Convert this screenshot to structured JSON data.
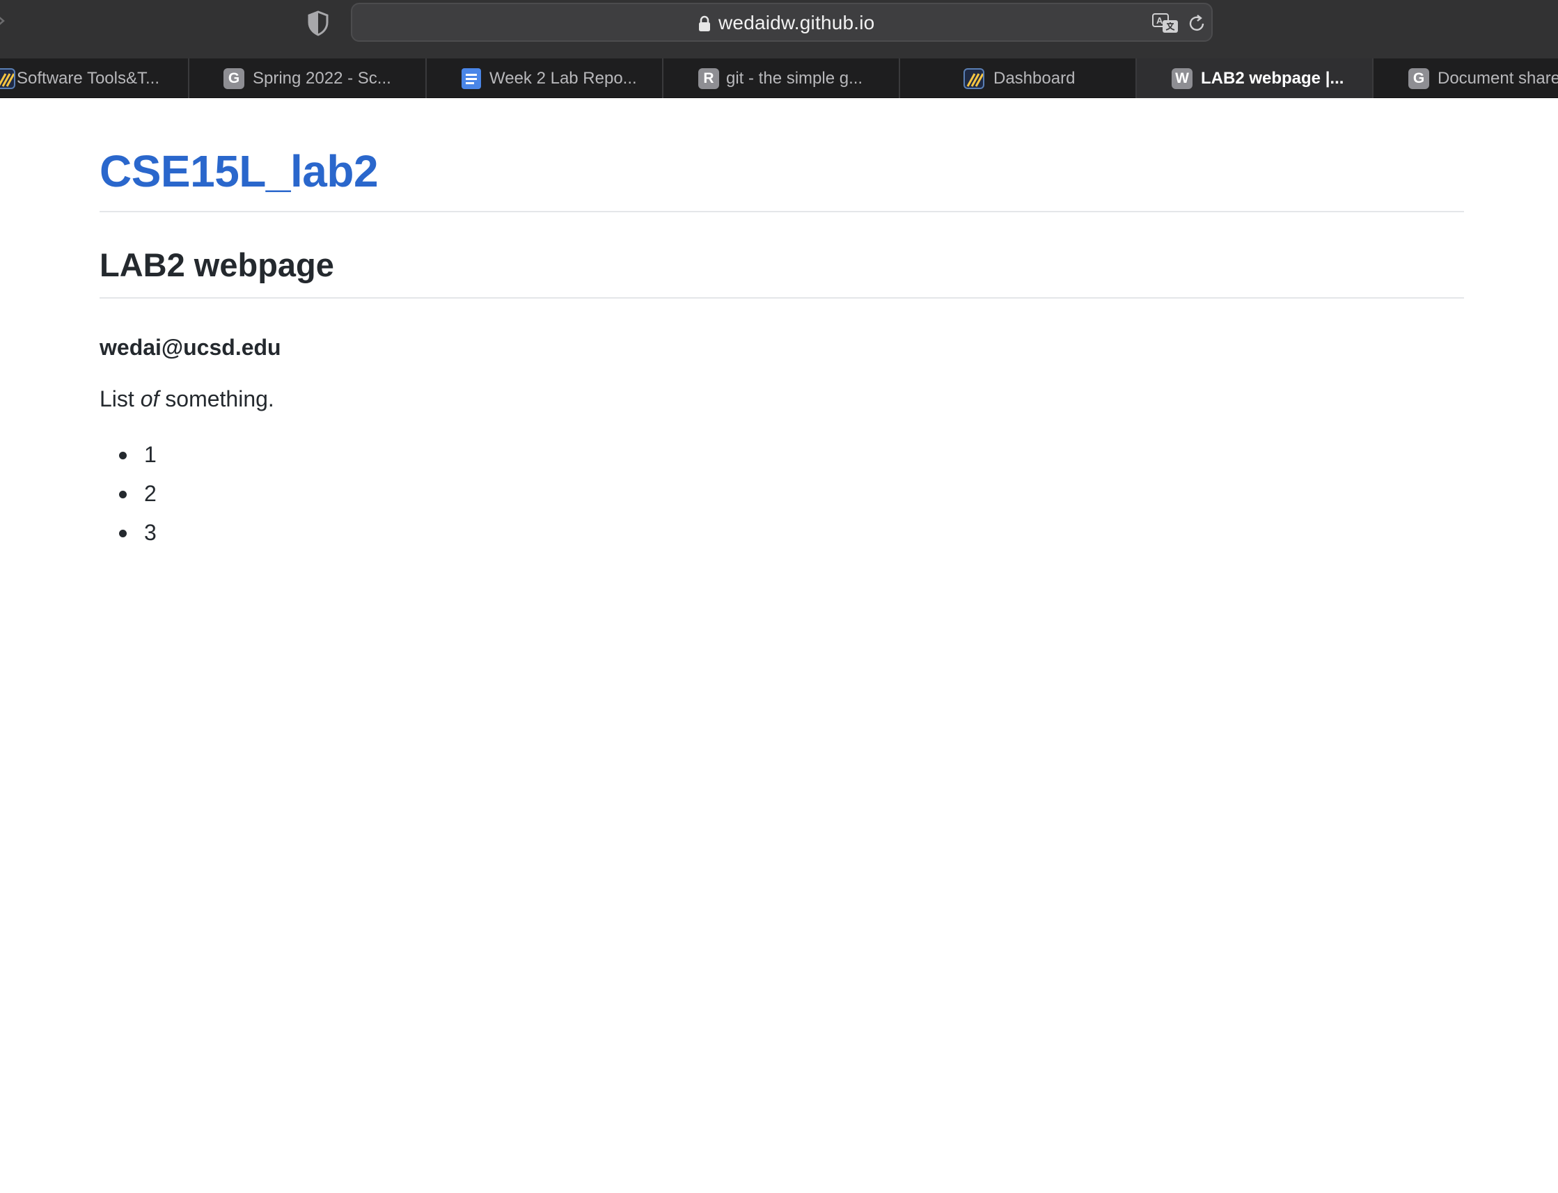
{
  "browser": {
    "url": "wedaidw.github.io",
    "tabs": [
      {
        "label": "Software Tools&T...",
        "favicon": "stripe",
        "active": false
      },
      {
        "label": "Spring 2022 - Sc...",
        "favicon": "G",
        "active": false
      },
      {
        "label": "Week 2 Lab Repo...",
        "favicon": "docs",
        "active": false
      },
      {
        "label": "git - the simple g...",
        "favicon": "R",
        "active": false
      },
      {
        "label": "Dashboard",
        "favicon": "stripe",
        "active": false
      },
      {
        "label": "LAB2 webpage |...",
        "favicon": "W",
        "active": true
      },
      {
        "label": "Document shared",
        "favicon": "G",
        "active": false
      }
    ],
    "icons": {
      "back": "chevron-left-icon",
      "privacy": "shield-icon",
      "lock": "lock-icon",
      "translate": "translate-icon",
      "reload": "reload-icon"
    }
  },
  "page": {
    "site_title": "CSE15L_lab2",
    "heading": "LAB2 webpage",
    "email": "wedai@ucsd.edu",
    "paragraph": {
      "before": "List ",
      "emphasis": "of",
      "after": " something."
    },
    "list_items": [
      "1",
      "2",
      "3"
    ]
  },
  "colors": {
    "link": "#2a67cc",
    "text": "#24292e",
    "toolbar": "#323233",
    "tabstrip": "#1e1e1f"
  }
}
